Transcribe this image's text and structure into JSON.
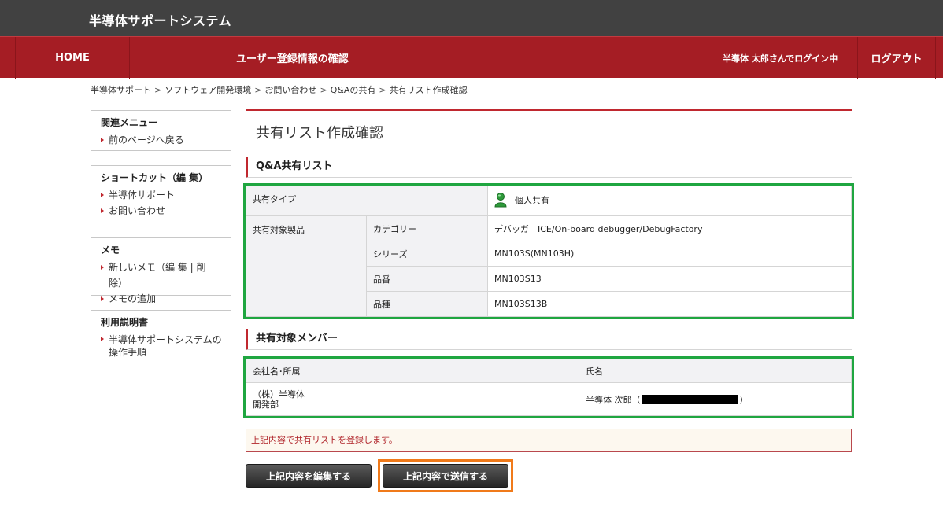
{
  "header": {
    "system_title": "半導体サポートシステム"
  },
  "nav": {
    "home": "HOME",
    "page": "ユーザー登録情報の確認",
    "user_status": "半導体 太郎さんでログイン中",
    "logout": "ログアウト"
  },
  "breadcrumb": [
    "半導体サポート",
    "ソフトウェア開発環境",
    "お問い合わせ",
    "Q&Aの共有",
    "共有リスト作成確認"
  ],
  "sidebar": {
    "related": {
      "title": "関連メニュー",
      "items": [
        "前のページへ戻る"
      ]
    },
    "shortcut": {
      "title": "ショートカット（編 集）",
      "items": [
        "半導体サポート",
        "お問い合わせ"
      ]
    },
    "memo": {
      "title": "メモ",
      "items": [
        "新しいメモ（編 集 | 削 除）",
        "メモの追加"
      ]
    },
    "manual": {
      "title": "利用説明書",
      "items": [
        "半導体サポートシステムの操作手順"
      ]
    }
  },
  "main": {
    "page_title": "共有リスト作成確認",
    "qa_section": {
      "title": "Q&A共有リスト",
      "share_type_label": "共有タイプ",
      "share_type_value": "個人共有",
      "target_product_label": "共有対象製品",
      "rows": [
        {
          "label": "カテゴリー",
          "value": "デバッガ　ICE/On-board debugger/DebugFactory"
        },
        {
          "label": "シリーズ",
          "value": "MN103S(MN103H)"
        },
        {
          "label": "品番",
          "value": "MN103S13"
        },
        {
          "label": "品種",
          "value": "MN103S13B"
        }
      ]
    },
    "member_section": {
      "title": "共有対象メンバー",
      "col_company": "会社名･所属",
      "col_name": "氏名",
      "company_line1": "（株）半導体",
      "company_line2": "開発部",
      "member_name": "半導体 次郎（",
      "member_name_close": "）"
    },
    "notice": "上記内容で共有リストを登録します。",
    "buttons": {
      "edit": "上記内容を編集する",
      "send": "上記内容で送信する"
    }
  },
  "colors": {
    "header_bg": "#414141",
    "nav_bg": "#a51d24",
    "accent": "#c0282f",
    "highlight_green": "#1fa640",
    "highlight_orange": "#f07a1a"
  }
}
